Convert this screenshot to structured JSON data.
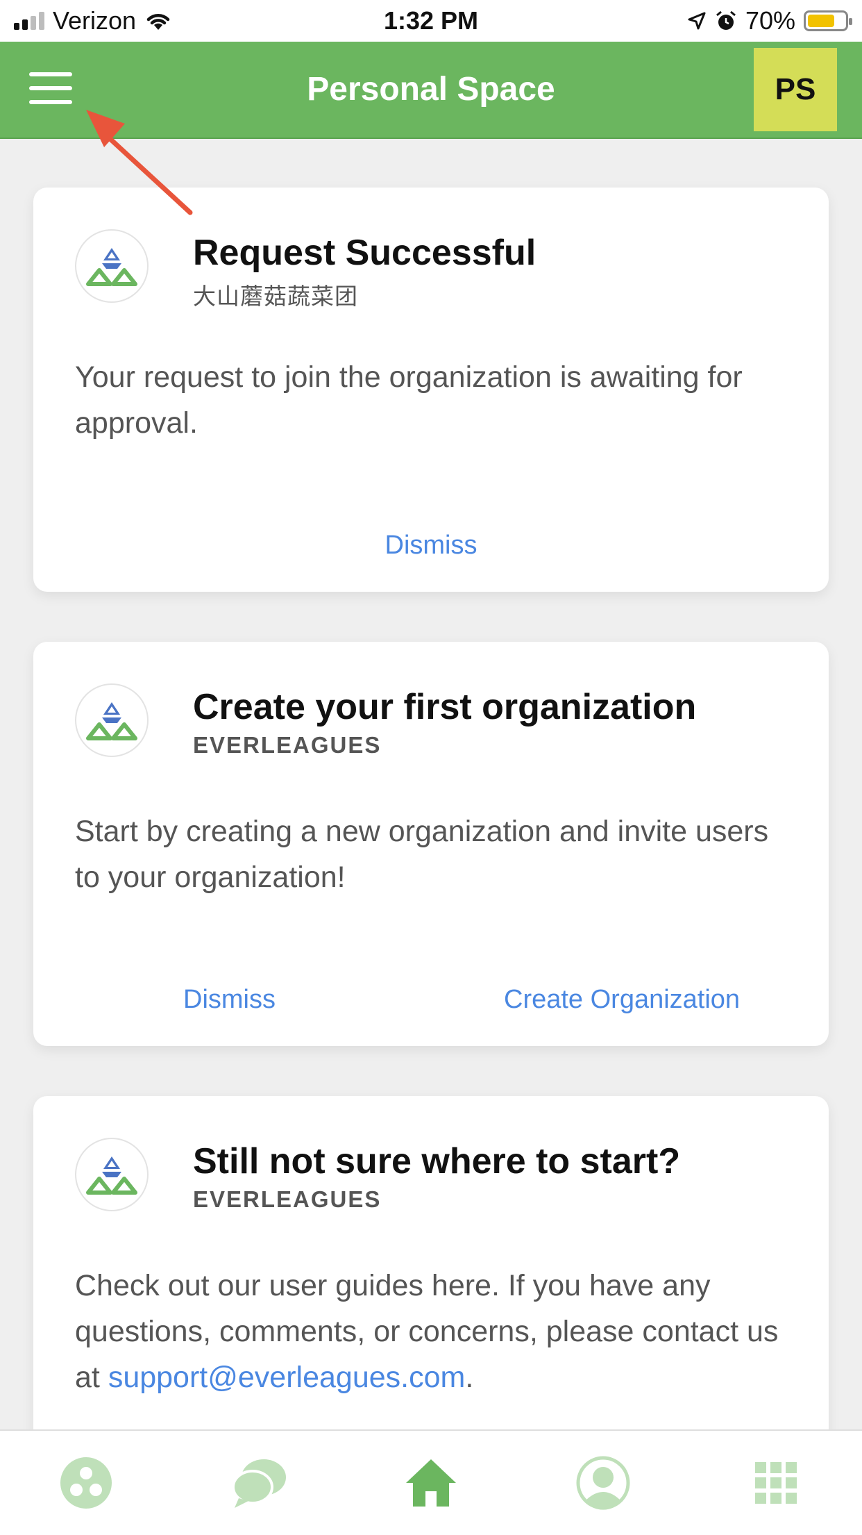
{
  "status_bar": {
    "carrier": "Verizon",
    "time": "1:32 PM",
    "battery": "70%"
  },
  "header": {
    "title": "Personal Space",
    "avatar_initials": "PS"
  },
  "cards": [
    {
      "title": "Request Successful",
      "subtitle": "大山蘑菇蔬菜团",
      "body": "Your request to join the organization is awaiting for approval.",
      "actions": [
        "Dismiss"
      ]
    },
    {
      "title": "Create your first organization",
      "subtitle": "EVERLEAGUES",
      "body": "Start by creating a new organization and invite users to your organization!",
      "actions": [
        "Dismiss",
        "Create Organization"
      ]
    },
    {
      "title": "Still not sure where to start?",
      "subtitle": "EVERLEAGUES",
      "body_before_link": "Check out our user guides here. If you have any questions, comments, or concerns, please contact us at ",
      "body_link": "support@everleagues.com",
      "body_after_link": "."
    }
  ],
  "tab_bar": {
    "items": [
      "groups-icon",
      "chat-icon",
      "home-icon",
      "contacts-icon",
      "apps-grid-icon"
    ],
    "active_index": 2
  },
  "colors": {
    "brand_green": "#6bb65f",
    "avatar_bg": "#d4dd57",
    "link_blue": "#4a87e1",
    "arrow_red": "#e8553b",
    "tab_inactive": "#bfe0b9",
    "tab_active": "#6bb65f"
  }
}
